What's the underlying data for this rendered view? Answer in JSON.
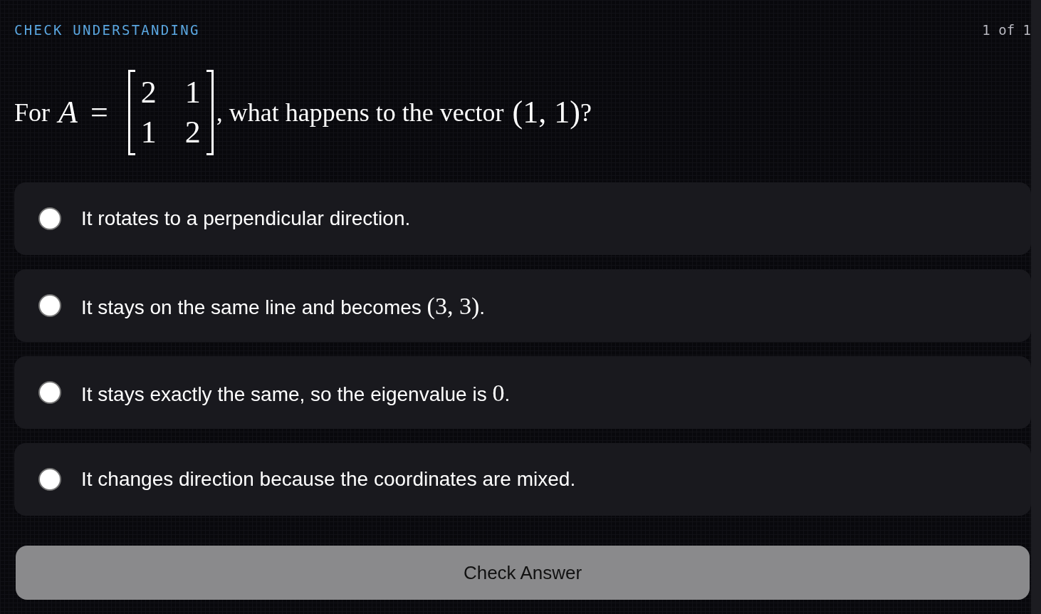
{
  "header": {
    "title": "CHECK UNDERSTANDING",
    "counter": "1 of 1"
  },
  "question": [
    {
      "kind": "text",
      "text": "For"
    },
    {
      "kind": "var",
      "text": "A"
    },
    {
      "kind": "op",
      "text": "="
    },
    {
      "kind": "matrix",
      "rows": [
        [
          "2",
          "1"
        ],
        [
          "1",
          "2"
        ]
      ]
    },
    {
      "kind": "text",
      "text": ", what happens to the vector"
    },
    {
      "kind": "math",
      "text": "(1, 1)"
    },
    {
      "kind": "text",
      "text": "?"
    }
  ],
  "options": [
    {
      "selected": false,
      "parts": [
        {
          "kind": "text",
          "text": "It rotates to a perpendicular direction."
        }
      ]
    },
    {
      "selected": false,
      "parts": [
        {
          "kind": "text",
          "text": "It stays on the same line and becomes "
        },
        {
          "kind": "math",
          "text": "(3, 3)"
        },
        {
          "kind": "text",
          "text": "."
        }
      ]
    },
    {
      "selected": false,
      "parts": [
        {
          "kind": "text",
          "text": "It stays exactly the same, so the eigenvalue is "
        },
        {
          "kind": "math",
          "text": "0"
        },
        {
          "kind": "text",
          "text": "."
        }
      ]
    },
    {
      "selected": false,
      "parts": [
        {
          "kind": "text",
          "text": "It changes direction because the coordinates are mixed."
        }
      ]
    }
  ],
  "submit": {
    "label": "Check Answer",
    "disabled": true
  }
}
